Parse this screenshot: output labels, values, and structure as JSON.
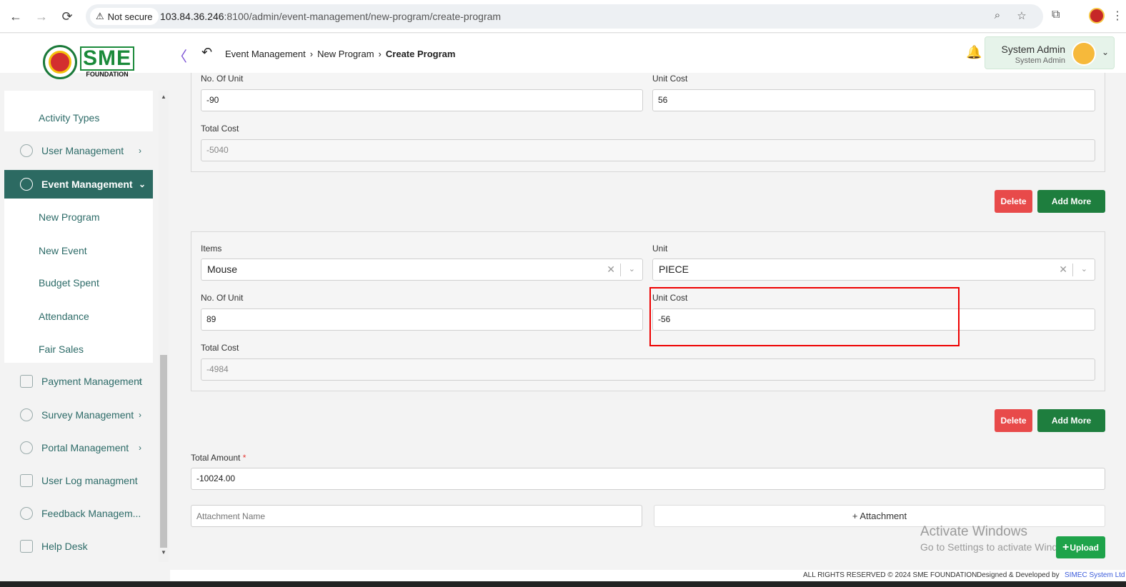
{
  "browser": {
    "not_secure_label": "Not secure",
    "url_host": "103.84.36.246",
    "url_rest": ":8100/admin/event-management/new-program/create-program",
    "back_glyph": "←",
    "forward_glyph": "→",
    "reload_glyph": "⟳"
  },
  "header": {
    "logo_text": "SME",
    "logo_sub": "FOUNDATION",
    "breadcrumb": [
      "Event Management",
      "New Program",
      "Create Program"
    ],
    "user_name": "System Admin",
    "user_role": "System Admin"
  },
  "sidebar": {
    "top_sub": "Activity Types",
    "items": [
      {
        "label": "User Management",
        "icon": "shield-icon"
      },
      {
        "label": "Event Management",
        "icon": "lock-icon"
      },
      {
        "label": "Payment Management",
        "icon": "payment-icon"
      },
      {
        "label": "Survey Management",
        "icon": "pie-chart-icon"
      },
      {
        "label": "Portal Management",
        "icon": "lock-icon"
      },
      {
        "label": "User Log managment",
        "icon": "log-icon"
      },
      {
        "label": "Feedback Managem...",
        "icon": "feedback-icon"
      },
      {
        "label": "Help Desk",
        "icon": "chat-icon"
      }
    ],
    "event_sub": [
      "New Program",
      "New Event",
      "Budget Spent",
      "Attendance",
      "Fair Sales"
    ]
  },
  "form": {
    "block1": {
      "no_of_unit_label": "No. Of Unit",
      "no_of_unit": "-90",
      "unit_cost_label": "Unit Cost",
      "unit_cost": "56",
      "total_cost_label": "Total Cost",
      "total_cost": "-5040"
    },
    "block2": {
      "items_label": "Items",
      "items_value": "Mouse",
      "unit_label": "Unit",
      "unit_value": "PIECE",
      "no_of_unit_label": "No. Of Unit",
      "no_of_unit": "89",
      "unit_cost_label": "Unit Cost",
      "unit_cost": "-56",
      "total_cost_label": "Total Cost",
      "total_cost": "-4984"
    },
    "delete_label": "Delete",
    "add_more_label": "Add More",
    "total_amount_label": "Total Amount",
    "total_amount_required": "*",
    "total_amount": "-10024.00",
    "attachment_placeholder": "Attachment Name",
    "attachment_button": "+ Attachment",
    "upload_label": "Upload"
  },
  "watermark": {
    "line1": "Activate Windows",
    "line2": "Go to Settings to activate Windows."
  },
  "footer": {
    "rights": "ALL RIGHTS RESERVED © 2024 SME FOUNDATION",
    "designed": "Designed & Developed by",
    "company": "SIMEC System Ltd"
  },
  "colors": {
    "primary": "#2c6a62",
    "danger": "#e84a4a",
    "success": "#1e7e3e",
    "highlight": "#ee0000"
  }
}
